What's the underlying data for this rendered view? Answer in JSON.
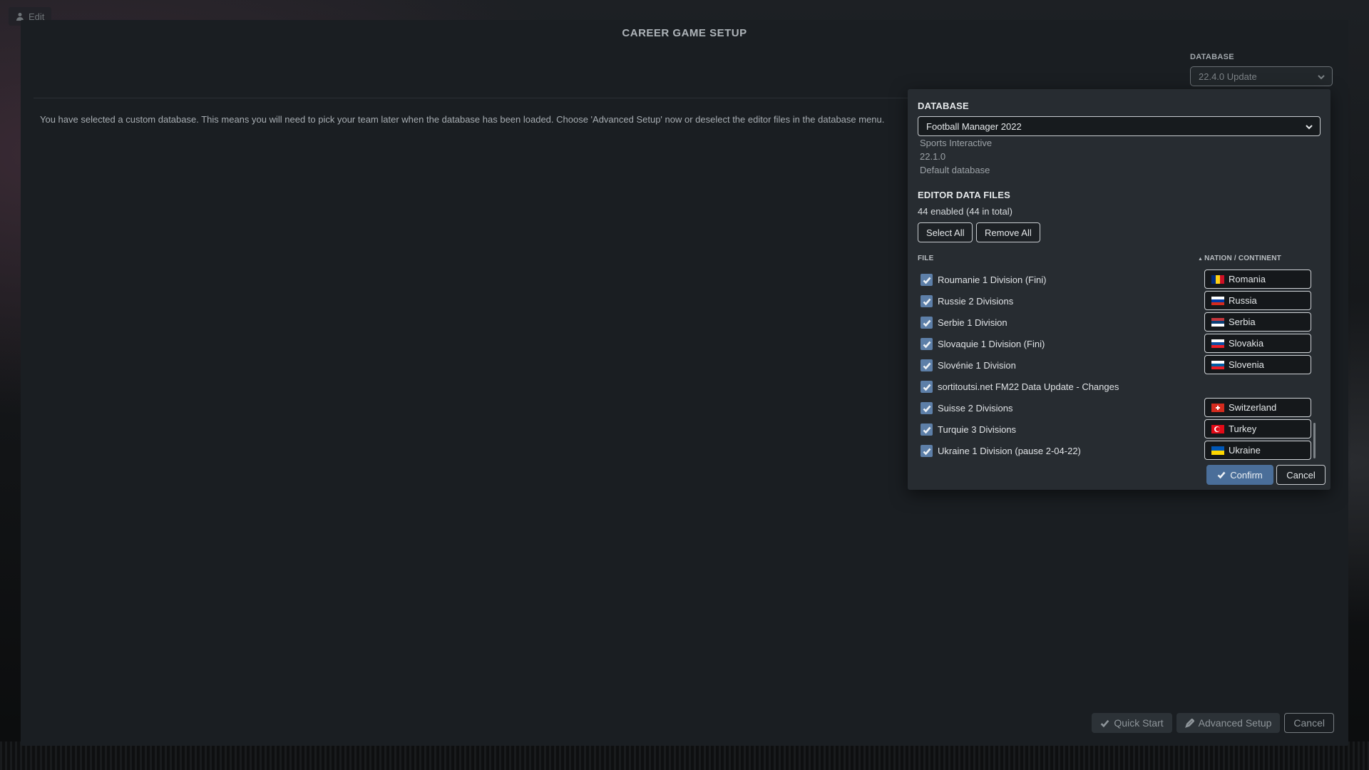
{
  "edit": {
    "label": "Edit"
  },
  "screen": {
    "title": "CAREER GAME SETUP",
    "database_label": "DATABASE",
    "database_selected": "22.4.0 Update",
    "notice": "You have selected a custom database. This means you will need to pick your team later when the database has been loaded. Choose 'Advanced Setup' now or deselect the editor files in the database menu."
  },
  "footer": {
    "quick_start": "Quick Start",
    "advanced_setup": "Advanced Setup",
    "cancel": "Cancel"
  },
  "popup": {
    "database_heading": "DATABASE",
    "database_selected": "Football Manager 2022",
    "developer": "Sports Interactive",
    "version": "22.1.0",
    "description": "Default database",
    "editor_heading": "EDITOR DATA FILES",
    "enabled_count": "44 enabled (44 in total)",
    "select_all": "Select All",
    "remove_all": "Remove All",
    "col_file": "FILE",
    "col_nation": "NATION / CONTINENT",
    "files": [
      {
        "name": "Roumanie 1 Division (Fini)",
        "nation": "Romania",
        "flag": "romania"
      },
      {
        "name": "Russie 2 Divisions",
        "nation": "Russia",
        "flag": "russia"
      },
      {
        "name": "Serbie 1 Division",
        "nation": "Serbia",
        "flag": "serbia"
      },
      {
        "name": "Slovaquie 1 Division (Fini)",
        "nation": "Slovakia",
        "flag": "slovakia"
      },
      {
        "name": "Slovénie 1 Division",
        "nation": "Slovenia",
        "flag": "slovenia"
      },
      {
        "name": "sortitoutsi.net FM22 Data Update - Changes",
        "nation": "",
        "flag": ""
      },
      {
        "name": "Suisse 2 Divisions",
        "nation": "Switzerland",
        "flag": "switzerland"
      },
      {
        "name": "Turquie 3 Divisions",
        "nation": "Turkey",
        "flag": "turkey"
      },
      {
        "name": "Ukraine 1 Division (pause 2-04-22)",
        "nation": "Ukraine",
        "flag": "ukraine"
      }
    ],
    "confirm": "Confirm",
    "cancel": "Cancel"
  },
  "colors": {
    "accent": "#4a6e99",
    "checkbox": "#5d7fa8"
  }
}
